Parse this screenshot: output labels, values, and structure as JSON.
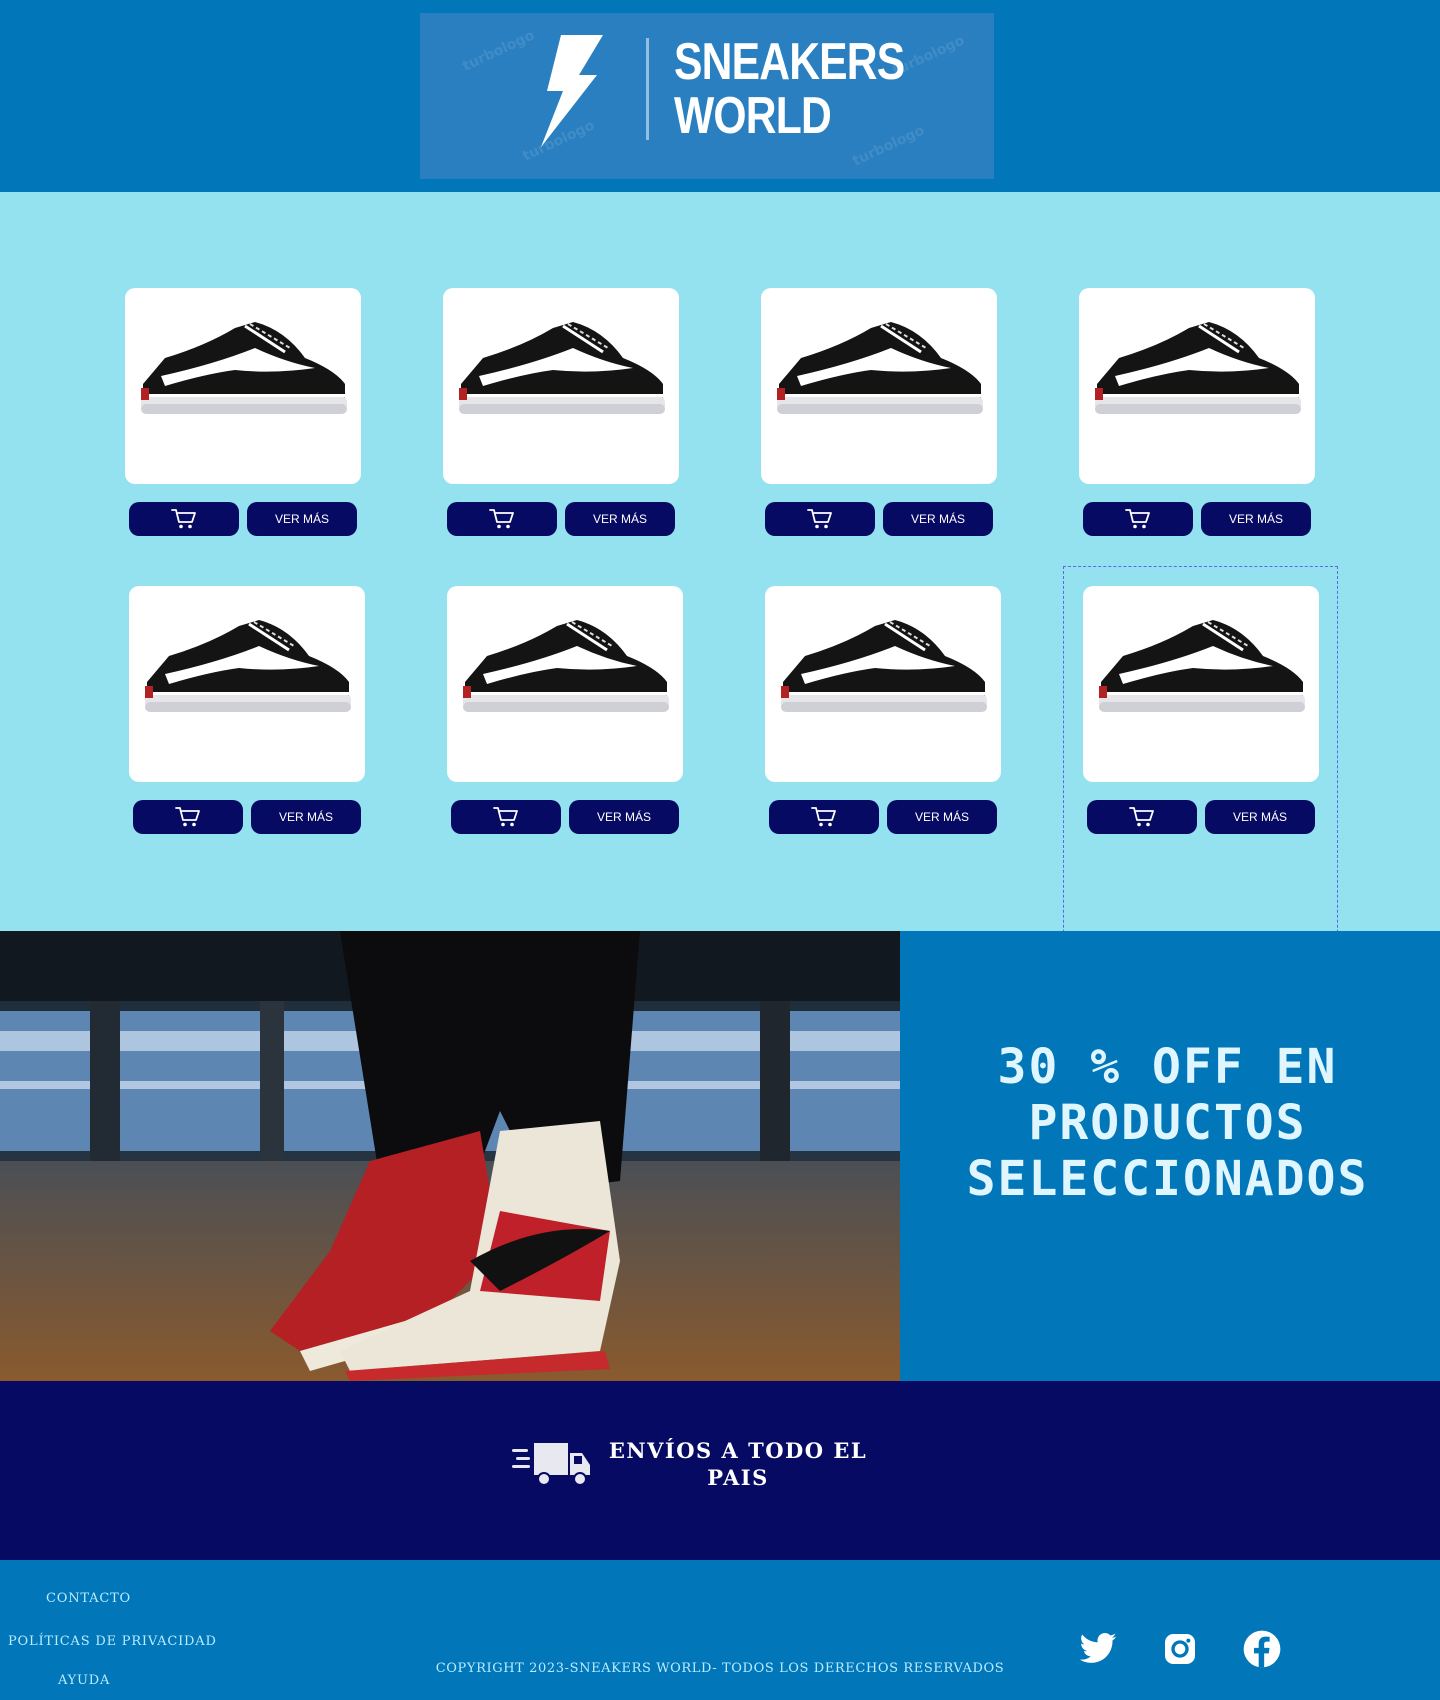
{
  "header": {
    "logo_line1": "SNEAKERS",
    "logo_line2": "WORLD",
    "watermark": "turbologo"
  },
  "products": {
    "items": [
      {
        "cart_icon": "cart-icon",
        "more_label": "VER MÁS"
      },
      {
        "cart_icon": "cart-icon",
        "more_label": "VER MÁS"
      },
      {
        "cart_icon": "cart-icon",
        "more_label": "VER MÁS"
      },
      {
        "cart_icon": "cart-icon",
        "more_label": "VER MÁS"
      },
      {
        "cart_icon": "cart-icon",
        "more_label": "VER MÁS"
      },
      {
        "cart_icon": "cart-icon",
        "more_label": "VER MÁS"
      },
      {
        "cart_icon": "cart-icon",
        "more_label": "VER MÁS"
      },
      {
        "cart_icon": "cart-icon",
        "more_label": "VER MÁS"
      }
    ]
  },
  "promo": {
    "line1": "30 % OFF EN",
    "line2": "PRODUCTOS",
    "line3": "SELECCIONADOS"
  },
  "shipping": {
    "icon": "truck-icon",
    "line1": "ENVÍOS A TODO EL",
    "line2": "PAIS"
  },
  "footer": {
    "links": {
      "contact": "CONTACTO",
      "privacy": "POLÍTICAS DE PRIVACIDAD",
      "help": "AYUDA"
    },
    "copyright": "COPYRIGHT 2023-SNEAKERS WORLD- TODOS LOS DERECHOS RESERVADOS",
    "social": [
      "twitter-icon",
      "instagram-icon",
      "facebook-icon"
    ]
  },
  "colors": {
    "primary_blue": "#0176b9",
    "light_cyan": "#94e1f0",
    "navy": "#070a63",
    "white": "#ffffff"
  }
}
